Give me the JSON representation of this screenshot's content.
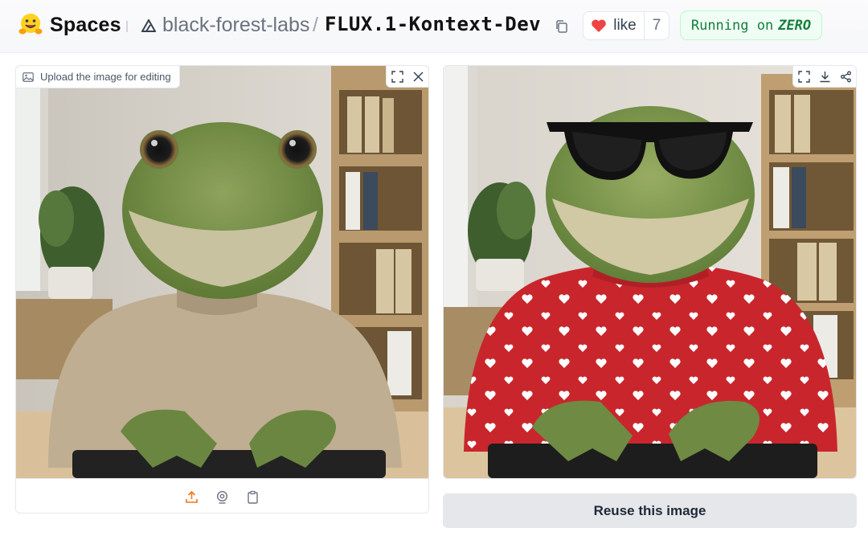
{
  "header": {
    "logo_icon": "hugging-face-emoji-icon",
    "spaces_label": "Spaces",
    "org_name": "black-forest-labs",
    "slash": "/",
    "repo_name": "FLUX.1-Kontext-Dev",
    "like_label": "like",
    "like_count": "7",
    "status_prefix": "Running on",
    "status_hardware": "ZERO"
  },
  "input_panel": {
    "label": "Upload the image for editing",
    "tools": [
      "fullscreen-icon",
      "close-icon"
    ],
    "bottom_tools": [
      "upload-icon",
      "webcam-icon",
      "clipboard-icon"
    ],
    "image_description_icon": "frog-beige-sweater-image"
  },
  "output_panel": {
    "tools": [
      "fullscreen-icon",
      "download-icon",
      "share-icon"
    ],
    "image_description_icon": "frog-sunglasses-red-sweater-image"
  },
  "reuse_button_label": "Reuse this image",
  "colors": {
    "accent_orange": "#f97316",
    "status_green": "#15803d",
    "status_bg": "#f0fdf4",
    "heart_red": "#ef4444",
    "button_bg": "#e5e7eb"
  }
}
